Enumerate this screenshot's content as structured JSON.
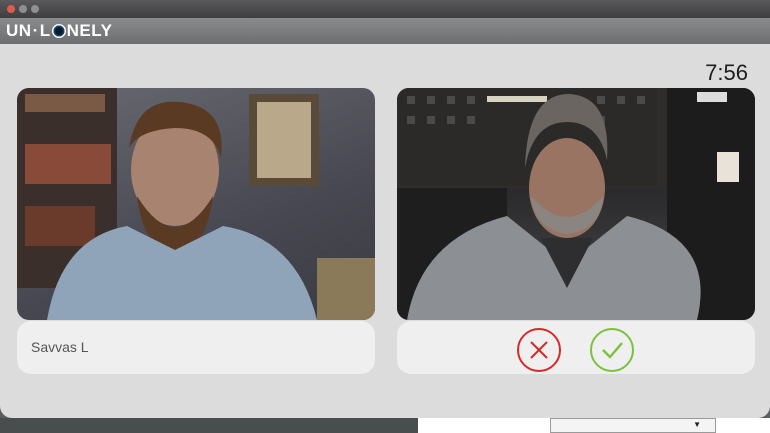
{
  "app": {
    "logo_text_left": "UN",
    "logo_text_right": "NELY",
    "logo_dot": "·"
  },
  "call": {
    "timer": "7:56",
    "caller_name": "Savvas L"
  },
  "actions": {
    "decline_icon": "close-icon",
    "accept_icon": "check-icon",
    "decline_color": "#d32a2a",
    "accept_color": "#7bc03e"
  },
  "background": {
    "dropdown_icon": "chevron-down-icon"
  }
}
